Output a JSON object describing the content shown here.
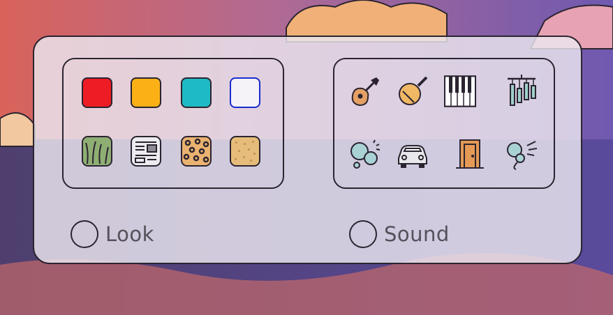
{
  "options": {
    "look": {
      "label": "Look",
      "swatches": [
        {
          "name": "red",
          "color": "#ee1c25"
        },
        {
          "name": "orange",
          "color": "#fbb116"
        },
        {
          "name": "teal",
          "color": "#1ebbc4"
        },
        {
          "name": "clear",
          "color": "#f5f3f8",
          "border": "#1a2bd0"
        }
      ],
      "textures": [
        "grass-texture-icon",
        "newspaper-texture-icon",
        "leopard-texture-icon",
        "sand-texture-icon"
      ]
    },
    "sound": {
      "label": "Sound",
      "icons_row1": [
        "guitar-icon",
        "maraca-icon",
        "piano-keys-icon",
        "wind-chimes-icon"
      ],
      "icons_row2": [
        "bubbles-icon",
        "car-icon",
        "door-icon",
        "whoosh-icon"
      ]
    }
  }
}
